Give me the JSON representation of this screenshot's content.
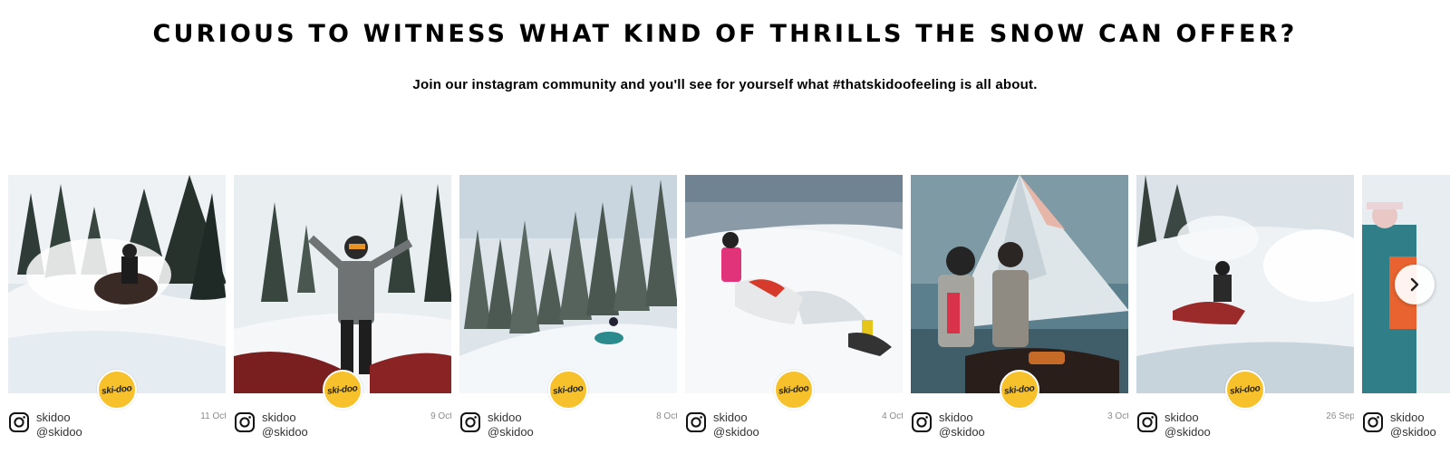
{
  "header": {
    "headline": "CURIOUS TO WITNESS WHAT KIND OF THRILLS THE SNOW CAN OFFER?",
    "subtext": "Join our instagram community and you'll see for yourself what #thatskidoofeeling is all about."
  },
  "feed": {
    "brand_badge_text": "ski-doo",
    "brand_color": "#f6c12a",
    "platform_icon": "instagram-icon",
    "next_icon": "chevron-right-icon",
    "posts": [
      {
        "username": "skidoo",
        "handle": "@skidoo",
        "date": "11 Oct"
      },
      {
        "username": "skidoo",
        "handle": "@skidoo",
        "date": "9 Oct"
      },
      {
        "username": "skidoo",
        "handle": "@skidoo",
        "date": "8 Oct"
      },
      {
        "username": "skidoo",
        "handle": "@skidoo",
        "date": "4 Oct"
      },
      {
        "username": "skidoo",
        "handle": "@skidoo",
        "date": "3 Oct"
      },
      {
        "username": "skidoo",
        "handle": "@skidoo",
        "date": "26 Sep"
      },
      {
        "username": "skidoo",
        "handle": "@skidoo",
        "date": ""
      }
    ]
  }
}
